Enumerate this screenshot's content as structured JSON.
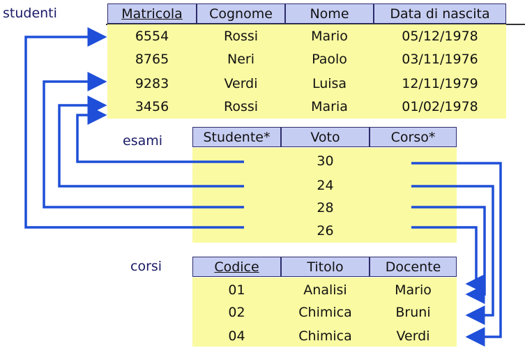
{
  "colors": {
    "header_fill": "#c6cdf2",
    "body_fill": "#fafaa2",
    "arrow": "#1f4fd8",
    "table_name": "#1a1a66"
  },
  "studenti": {
    "name": "studenti",
    "headers": [
      "Matricola",
      "Cognome",
      "Nome",
      "Data di nascita"
    ],
    "key_header": "Matricola",
    "rows": [
      [
        "6554",
        "Rossi",
        "Mario",
        "05/12/1978"
      ],
      [
        "8765",
        "Neri",
        "Paolo",
        "03/11/1976"
      ],
      [
        "9283",
        "Verdi",
        "Luisa",
        "12/11/1979"
      ],
      [
        "3456",
        "Rossi",
        "Maria",
        "01/02/1978"
      ]
    ]
  },
  "esami": {
    "name": "esami",
    "headers": [
      "Studente*",
      "Voto",
      "Corso*"
    ],
    "rows": [
      [
        "",
        "30",
        ""
      ],
      [
        "",
        "24",
        ""
      ],
      [
        "",
        "28",
        ""
      ],
      [
        "",
        "26",
        ""
      ]
    ]
  },
  "corsi": {
    "name": "corsi",
    "headers": [
      "Codice",
      "Titolo",
      "Docente"
    ],
    "key_header": "Codice",
    "rows": [
      [
        "01",
        "Analisi",
        "Mario"
      ],
      [
        "02",
        "Chimica",
        "Bruni"
      ],
      [
        "04",
        "Chimica",
        "Verdi"
      ]
    ]
  }
}
